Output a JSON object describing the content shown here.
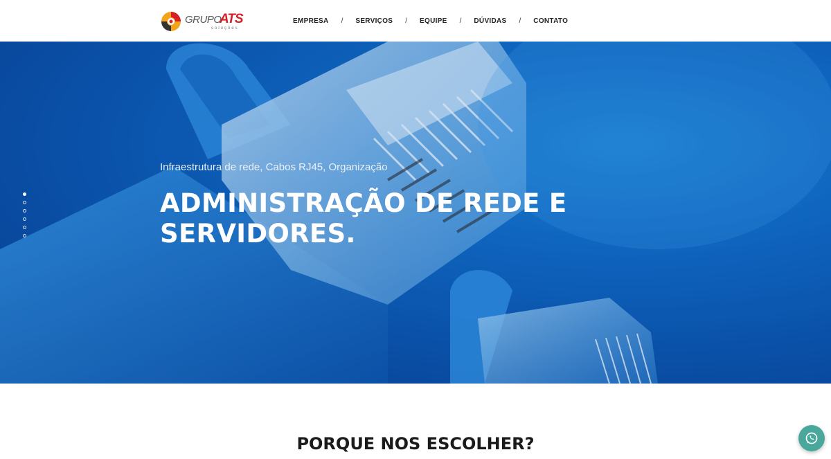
{
  "header": {
    "logo": {
      "name": "GRUPO",
      "brand": "ATS",
      "tagline": "soluções"
    },
    "nav": {
      "items": [
        {
          "label": "EMPRESA"
        },
        {
          "label": "SERVIÇOS"
        },
        {
          "label": "EQUIPE"
        },
        {
          "label": "DÚVIDAS"
        },
        {
          "label": "CONTATO"
        }
      ],
      "separator": "/"
    }
  },
  "hero": {
    "subtitle": "Infraestrutura de rede, Cabos RJ45, Organização",
    "title": "ADMINISTRAÇÃO DE REDE E SERVIDORES.",
    "slider": {
      "slides": 6,
      "active": 1
    }
  },
  "section": {
    "title": "PORQUE NOS ESCOLHER?"
  },
  "floating": {
    "icon": "whatsapp-icon",
    "color": "#4aa79b"
  },
  "colors": {
    "brand_red": "#d61f26",
    "hero_blue": "#0f66c2",
    "text_dark": "#1a1a1a"
  }
}
